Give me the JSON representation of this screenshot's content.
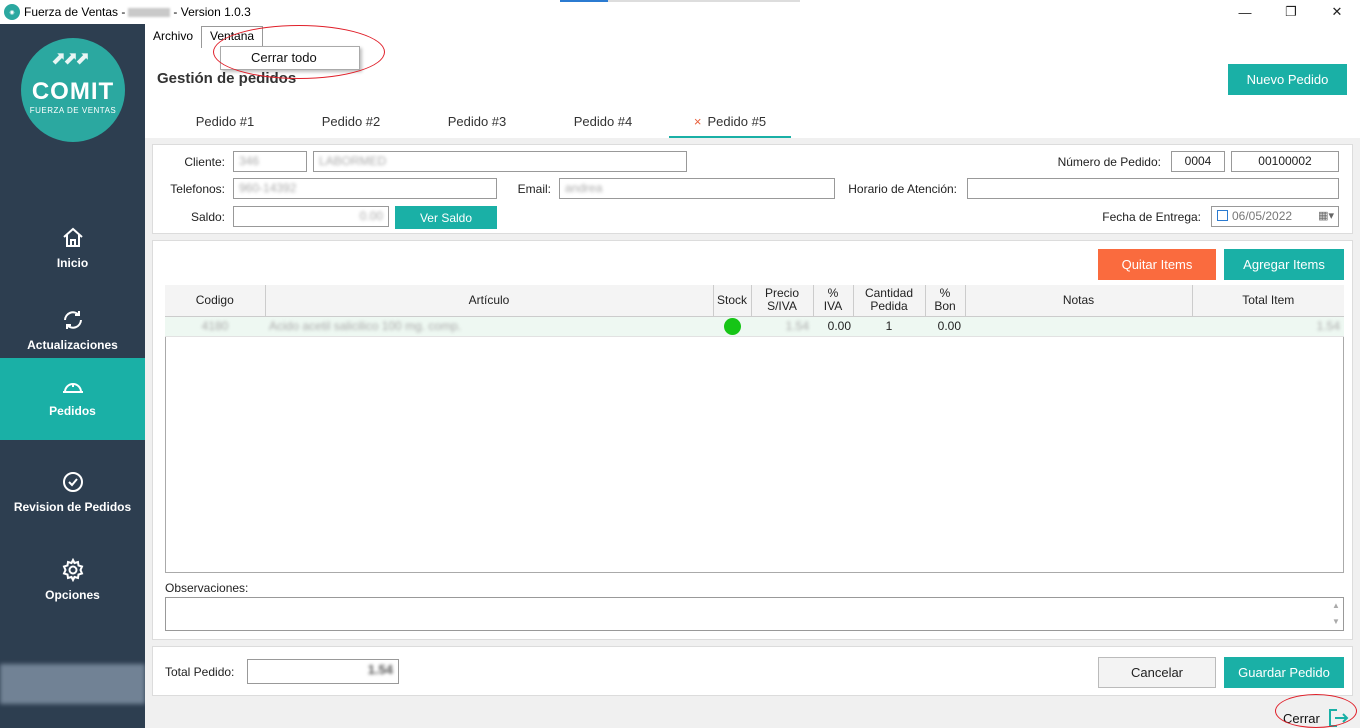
{
  "window": {
    "title_prefix": "Fuerza de Ventas -",
    "title_suffix": "- Version 1.0.3",
    "minimize": "—",
    "maximize": "❐",
    "close": "✕"
  },
  "sidebar": {
    "logo_text": "COMIT",
    "logo_tagline": "FUERZA DE VENTAS",
    "items": [
      {
        "label": "Inicio",
        "icon": "home-icon"
      },
      {
        "label": "Actualizaciones",
        "icon": "refresh-icon"
      },
      {
        "label": "Pedidos",
        "icon": "order-icon",
        "active": true
      },
      {
        "label": "Revision de Pedidos",
        "icon": "check-circle-icon"
      },
      {
        "label": "Opciones",
        "icon": "gear-icon"
      }
    ]
  },
  "menubar": {
    "items": [
      "Archivo",
      "Ventana"
    ],
    "open_menu": "Ventana",
    "dropdown_item": "Cerrar todo"
  },
  "page": {
    "title": "Gestión de pedidos",
    "new_order_button": "Nuevo Pedido"
  },
  "tabs": [
    {
      "label": "Pedido #1"
    },
    {
      "label": "Pedido #2"
    },
    {
      "label": "Pedido #3"
    },
    {
      "label": "Pedido #4"
    },
    {
      "label": "Pedido #5",
      "active": true,
      "close": "×"
    }
  ],
  "header_form": {
    "cliente_label": "Cliente:",
    "cliente_code": "346",
    "cliente_name": "LABORMED",
    "numero_label": "Número de Pedido:",
    "numero_serie": "0004",
    "numero_pedido": "00100002",
    "telefonos_label": "Telefonos:",
    "telefonos_value": "960-14392",
    "email_label": "Email:",
    "email_value": "andrea",
    "horario_label": "Horario de Atención:",
    "horario_value": "",
    "saldo_label": "Saldo:",
    "saldo_value": "0.00",
    "ver_saldo_button": "Ver Saldo",
    "fecha_label": "Fecha de Entrega:",
    "fecha_value": "06/05/2022"
  },
  "items_panel": {
    "quitar_button": "Quitar Items",
    "agregar_button": "Agregar Items",
    "columns": [
      {
        "line1": "Codigo",
        "line2": ""
      },
      {
        "line1": "Artículo",
        "line2": ""
      },
      {
        "line1": "Stock",
        "line2": ""
      },
      {
        "line1": "Precio",
        "line2": "S/IVA"
      },
      {
        "line1": "%",
        "line2": "IVA"
      },
      {
        "line1": "Cantidad",
        "line2": "Pedida"
      },
      {
        "line1": "%",
        "line2": "Bon"
      },
      {
        "line1": "Notas",
        "line2": ""
      },
      {
        "line1": "Total Item",
        "line2": ""
      }
    ],
    "rows": [
      {
        "codigo": "4180",
        "articulo": "Acido acetil salicilico 100 mg. comp.",
        "stock": "in-stock",
        "precio": "1.54",
        "iva": "0.00",
        "cantidad": "1",
        "bon": "0.00",
        "notas": "",
        "total": "1.54"
      }
    ],
    "observaciones_label": "Observaciones:",
    "observaciones_value": ""
  },
  "footer": {
    "total_label": "Total Pedido:",
    "total_value": "1.54",
    "cancelar_button": "Cancelar",
    "guardar_button": "Guardar Pedido",
    "cerrar_label": "Cerrar"
  },
  "colors": {
    "sidebar_bg": "#2d3e50",
    "accent_teal": "#1ab0a6",
    "accent_orange": "#fa6b3e",
    "stock_green": "#16c516",
    "annotation_red": "#e0202a"
  }
}
